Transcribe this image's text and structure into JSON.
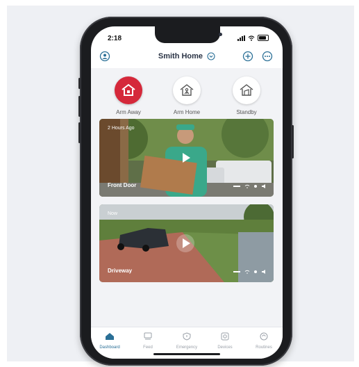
{
  "status_bar": {
    "time": "2:18"
  },
  "header": {
    "title": "Smith Home",
    "profile_icon": "user-circle-icon",
    "add_icon": "plus-circle-icon",
    "more_icon": "ellipsis-circle-icon"
  },
  "modes": [
    {
      "label": "Arm Away",
      "icon": "house-shield-icon",
      "active": true
    },
    {
      "label": "Arm Home",
      "icon": "house-person-icon",
      "active": false
    },
    {
      "label": "Standby",
      "icon": "house-open-icon",
      "active": false
    }
  ],
  "cameras": [
    {
      "name": "Front Door",
      "time": "2 Hours Ago"
    },
    {
      "name": "Driveway",
      "time": "Now"
    }
  ],
  "tabs": [
    {
      "label": "Dashboard",
      "icon": "home-icon",
      "active": true
    },
    {
      "label": "Feed",
      "icon": "feed-icon",
      "active": false
    },
    {
      "label": "Emergency",
      "icon": "shield-icon",
      "active": false
    },
    {
      "label": "Devices",
      "icon": "camera-icon",
      "active": false
    },
    {
      "label": "Routines",
      "icon": "routine-icon",
      "active": false
    }
  ],
  "colors": {
    "accent": "#2a6f96",
    "arm_active": "#d5283a"
  }
}
